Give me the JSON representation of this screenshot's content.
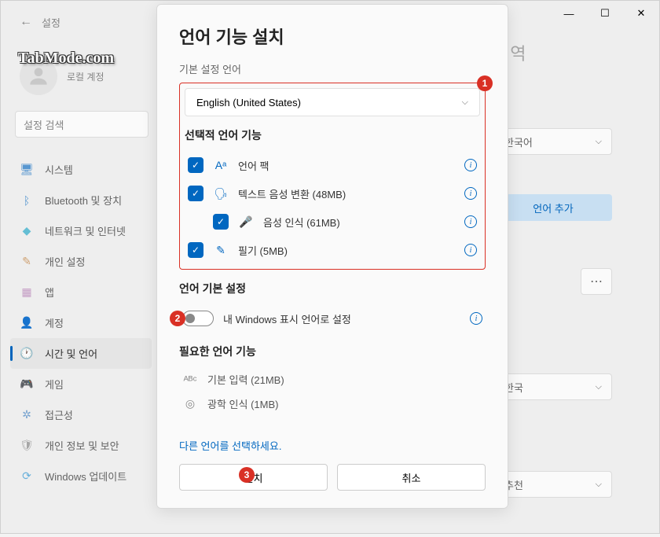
{
  "window": {
    "back_label": "←",
    "settings_label": "설정",
    "watermark": "TabMode.com",
    "user_account": "로컬 계정",
    "search_placeholder": "설정 검색"
  },
  "sidebar": {
    "items": [
      {
        "icon": "🖥",
        "label": "시스템",
        "color": "#5a9bd5"
      },
      {
        "icon": "ᛒ",
        "label": "Bluetooth 및 장치",
        "color": "#5a9bd5"
      },
      {
        "icon": "◆",
        "label": "네트워크 및 인터넷",
        "color": "#66c2d9"
      },
      {
        "icon": "✎",
        "label": "개인 설정",
        "color": "#d4a574"
      },
      {
        "icon": "▦",
        "label": "앱",
        "color": "#c9a0c9"
      },
      {
        "icon": "👤",
        "label": "계정",
        "color": "#8aba6f"
      },
      {
        "icon": "🕐",
        "label": "시간 및 언어",
        "color": "#888"
      },
      {
        "icon": "🎮",
        "label": "게임",
        "color": "#aaa"
      },
      {
        "icon": "✲",
        "label": "접근성",
        "color": "#7aa7d4"
      },
      {
        "icon": "🛡",
        "label": "개인 정보 및 보안",
        "color": "#aaa"
      },
      {
        "icon": "⟳",
        "label": "Windows 업데이트",
        "color": "#6cb5e0"
      }
    ],
    "active_index": 6
  },
  "modal": {
    "title": "언어 기능 설치",
    "default_lang_label": "기본 설정 언어",
    "selected_language": "English (United States)",
    "optional_heading": "선택적 언어 기능",
    "features": [
      {
        "label": "언어 팩",
        "icon": "Aᵃ"
      },
      {
        "label": "텍스트 음성 변환 (48MB)",
        "icon": "🗣"
      },
      {
        "label": "음성 인식 (61MB)",
        "icon": "🎤",
        "indented": true
      },
      {
        "label": "필기 (5MB)",
        "icon": "✎"
      }
    ],
    "prefs_heading": "언어 기본 설정",
    "display_lang_label": "내 Windows 표시 언어로 설정",
    "required_heading": "필요한 언어 기능",
    "required": [
      {
        "label": "기본 입력 (21MB)",
        "icon": "ᴬᴮᶜ"
      },
      {
        "label": "광학 인식 (1MB)",
        "icon": "◎"
      }
    ],
    "link_text": "다른 언어를 선택하세요.",
    "install_btn": "설치",
    "cancel_btn": "취소",
    "badges": {
      "one": "1",
      "two": "2",
      "three": "3"
    }
  },
  "background": {
    "title_fragment": "ㅣ역",
    "display_lang_value": "한국어",
    "add_lang_btn": "언어 추가",
    "country_value": "한국",
    "region_value": "추천",
    "more": "⋯"
  }
}
